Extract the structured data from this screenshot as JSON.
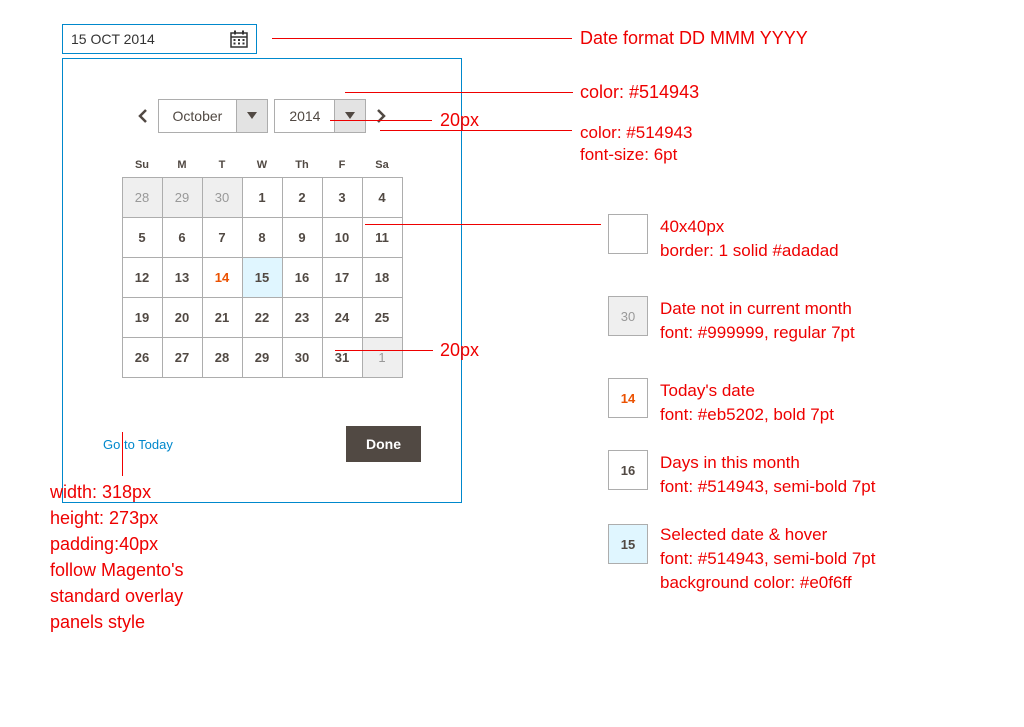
{
  "input": {
    "value": "15 OCT 2014"
  },
  "header": {
    "month": "October",
    "year": "2014"
  },
  "dow": [
    "Su",
    "M",
    "T",
    "W",
    "Th",
    "F",
    "Sa"
  ],
  "weeks": [
    [
      {
        "d": 28,
        "out": true
      },
      {
        "d": 29,
        "out": true
      },
      {
        "d": 30,
        "out": true
      },
      {
        "d": 1
      },
      {
        "d": 2
      },
      {
        "d": 3
      },
      {
        "d": 4
      }
    ],
    [
      {
        "d": 5
      },
      {
        "d": 6
      },
      {
        "d": 7
      },
      {
        "d": 8
      },
      {
        "d": 9
      },
      {
        "d": 10
      },
      {
        "d": 11
      }
    ],
    [
      {
        "d": 12
      },
      {
        "d": 13
      },
      {
        "d": 14,
        "today": true
      },
      {
        "d": 15,
        "sel": true
      },
      {
        "d": 16
      },
      {
        "d": 17
      },
      {
        "d": 18
      }
    ],
    [
      {
        "d": 19
      },
      {
        "d": 20
      },
      {
        "d": 21
      },
      {
        "d": 22
      },
      {
        "d": 23
      },
      {
        "d": 24
      },
      {
        "d": 25
      }
    ],
    [
      {
        "d": 26
      },
      {
        "d": 27
      },
      {
        "d": 28
      },
      {
        "d": 29
      },
      {
        "d": 30
      },
      {
        "d": 31
      },
      {
        "d": 1,
        "out": true
      }
    ]
  ],
  "footer": {
    "today_link": "Go to Today",
    "done": "Done"
  },
  "annotations": {
    "a1": "Date format DD MMM YYYY",
    "a2": "color: #514943",
    "a3": "20px",
    "a4_l1": "color: #514943",
    "a4_l2": "font-size: 6pt",
    "a5_l1": "40x40px",
    "a5_l2": "border: 1 solid #adadad",
    "a6_l1": "Date not in current month",
    "a6_l2": "font: #999999, regular 7pt",
    "a7_l1": "Today's date",
    "a7_l2": "font: #eb5202, bold 7pt",
    "a8_l1": "Days in this month",
    "a8_l2": "font: #514943, semi-bold 7pt",
    "a9_l1": "Selected date & hover",
    "a9_l2": "font: #514943, semi-bold 7pt",
    "a9_l3": "background color: #e0f6ff",
    "a10": "20px",
    "panel_l1": "width: 318px",
    "panel_l2": "height: 273px",
    "panel_l3": "padding:40px",
    "panel_l4": "follow Magento's",
    "panel_l5": "standard overlay",
    "panel_l6": "panels style"
  },
  "legend": {
    "s_out": "30",
    "s_today": "14",
    "s_normal": "16",
    "s_sel": "15"
  }
}
